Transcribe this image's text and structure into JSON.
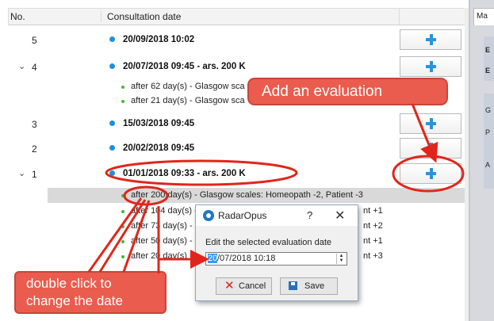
{
  "table": {
    "headers": {
      "no": "No.",
      "date": "Consultation date"
    },
    "consultations": [
      {
        "no": "5",
        "chevron": "",
        "label": "20/09/2018 10:02"
      },
      {
        "no": "4",
        "chevron": "✓",
        "label": "20/07/2018 09:45 - ars. 200 K"
      },
      {
        "no": "3",
        "chevron": "",
        "label": "15/03/2018 09:45"
      },
      {
        "no": "2",
        "chevron": "",
        "label": "20/02/2018 09:45"
      },
      {
        "no": "1",
        "chevron": "✓",
        "label": "01/01/2018 09:33 - ars. 200 K"
      }
    ],
    "evaluations_4": [
      "after 62 day(s) - Glasgow sca",
      "after 21 day(s) - Glasgow sca"
    ],
    "evaluations_1": [
      {
        "left": "after 200 day(s) - Glasgow scales: Homeopath -2, Patient -3",
        "right": ""
      },
      {
        "left": "after 104 day(s) -",
        "right": "nt +1"
      },
      {
        "left": "after 73 day(s) - C",
        "right": "nt +2"
      },
      {
        "left": "after 50 day(s) - C",
        "right": "nt +1"
      },
      {
        "left": "after 20 day(s) - C",
        "right": "nt +3"
      }
    ]
  },
  "side_panel": {
    "tab": "Ma",
    "letters": [
      "E",
      "E",
      "G",
      "P",
      "A"
    ]
  },
  "callouts": {
    "add_evaluation": "Add an evaluation",
    "double_click_line1": "double click to",
    "double_click_line2": "change the date"
  },
  "dialog": {
    "title": "RadarOpus",
    "help": "?",
    "close": "✕",
    "label": "Edit the selected evaluation date",
    "value_selected": "20",
    "value_rest": "/07/2018 10:18",
    "cancel_label": "Cancel",
    "save_label": "Save"
  },
  "colors": {
    "accent_blue": "#1e8fe0",
    "callout_red": "#ea5c4e",
    "annotation_red": "#e0261b"
  }
}
